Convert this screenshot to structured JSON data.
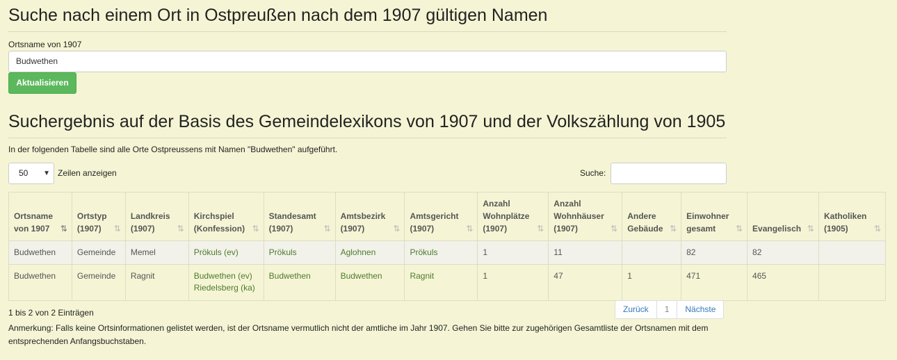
{
  "search_form": {
    "title": "Suche nach einem Ort in Ostpreußen nach dem 1907 gültigen Namen",
    "field_label": "Ortsname von 1907",
    "field_value": "Budwethen",
    "update_button": "Aktualisieren"
  },
  "results": {
    "title": "Suchergebnis auf der Basis des Gemeindelexikons von 1907 und der Volkszählung von 1905",
    "intro": "In der folgenden Tabelle sind alle Orte Ostpreussens mit Namen \"Budwethen\" aufgeführt.",
    "length_value": "50",
    "length_label": "Zeilen anzeigen",
    "search_label": "Suche:",
    "search_value": "",
    "columns": [
      {
        "line1": "Ortsname",
        "line2": "von 1907"
      },
      {
        "line1": "Ortstyp",
        "line2": "(1907)"
      },
      {
        "line1": "Landkreis",
        "line2": "(1907)"
      },
      {
        "line1": "Kirchspiel",
        "line2": "(Konfession)"
      },
      {
        "line1": "Standesamt",
        "line2": "(1907)"
      },
      {
        "line1": "Amtsbezirk",
        "line2": "(1907)"
      },
      {
        "line1": "Amtsgericht",
        "line2": "(1907)"
      },
      {
        "line0": "Anzahl",
        "line1": "Wohnplätze",
        "line2": "(1907)"
      },
      {
        "line0": "Anzahl",
        "line1": "Wohnhäuser",
        "line2": "(1907)"
      },
      {
        "line1": "Andere",
        "line2": "Gebäude"
      },
      {
        "line1": "Einwohner",
        "line2": "gesamt"
      },
      {
        "line1": "",
        "line2": "Evangelisch"
      },
      {
        "line1": "Katholiken",
        "line2": "(1905)"
      }
    ],
    "rows": [
      {
        "ortsname": "Budwethen",
        "ortstyp": "Gemeinde",
        "landkreis": "Memel",
        "kirchspiel": [
          "Prökuls (ev)"
        ],
        "standesamt": "Prökuls",
        "amtsbezirk": "Aglohnen",
        "amtsgericht": "Prökuls",
        "wohnplaetze": "1",
        "wohnhaeuser": "11",
        "andere": "",
        "einwohner": "82",
        "evangelisch": "82",
        "katholiken": ""
      },
      {
        "ortsname": "Budwethen",
        "ortstyp": "Gemeinde",
        "landkreis": "Ragnit",
        "kirchspiel": [
          "Budwethen (ev)",
          "Riedelsberg (ka)"
        ],
        "standesamt": "Budwethen",
        "amtsbezirk": "Budwethen",
        "amtsgericht": "Ragnit",
        "wohnplaetze": "1",
        "wohnhaeuser": "47",
        "andere": "1",
        "einwohner": "471",
        "evangelisch": "465",
        "katholiken": ""
      }
    ],
    "info": "1 bis 2 von 2 Einträgen",
    "pagination": {
      "prev": "Zurück",
      "page": "1",
      "next": "Nächste"
    },
    "note": "Anmerkung: Falls keine Ortsinformationen gelistet werden, ist der Ortsname vermutlich nicht der amtliche im Jahr 1907. Gehen Sie bitte zur zugehörigen Gesamtliste der Ortsnamen mit dem entsprechenden Anfangsbuchstaben."
  },
  "icons": {
    "sort": "sort-icon",
    "sort_active": "sort-asc-icon",
    "select_chevron": "chevron-down-icon"
  },
  "colors": {
    "background": "#f5f5d5",
    "button_green": "#5cb85c",
    "link_green": "#4d7a2d",
    "pager_blue": "#337ab7"
  }
}
